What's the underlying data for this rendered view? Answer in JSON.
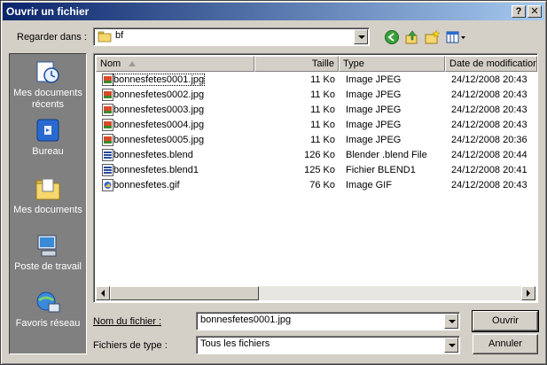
{
  "window": {
    "title": "Ouvrir un fichier",
    "help_btn": "?",
    "close_btn": "✕"
  },
  "lookin": {
    "label": "Regarder dans :",
    "value": "bf"
  },
  "places": [
    {
      "label": "Mes documents récents",
      "icon": "recent-documents-icon"
    },
    {
      "label": "Bureau",
      "icon": "desktop-icon"
    },
    {
      "label": "Mes documents",
      "icon": "my-documents-icon"
    },
    {
      "label": "Poste de travail",
      "icon": "my-computer-icon"
    },
    {
      "label": "Favoris réseau",
      "icon": "network-places-icon"
    }
  ],
  "columns": {
    "name": "Nom",
    "size": "Taille",
    "type": "Type",
    "date": "Date de modification"
  },
  "files": [
    {
      "name": "bonnesfetes0001.jpg",
      "size": "11 Ko",
      "type": "Image JPEG",
      "date": "24/12/2008 20:43",
      "icon": "jpeg-file-icon"
    },
    {
      "name": "bonnesfetes0002.jpg",
      "size": "11 Ko",
      "type": "Image JPEG",
      "date": "24/12/2008 20:43",
      "icon": "jpeg-file-icon"
    },
    {
      "name": "bonnesfetes0003.jpg",
      "size": "11 Ko",
      "type": "Image JPEG",
      "date": "24/12/2008 20:43",
      "icon": "jpeg-file-icon"
    },
    {
      "name": "bonnesfetes0004.jpg",
      "size": "11 Ko",
      "type": "Image JPEG",
      "date": "24/12/2008 20:43",
      "icon": "jpeg-file-icon"
    },
    {
      "name": "bonnesfetes0005.jpg",
      "size": "11 Ko",
      "type": "Image JPEG",
      "date": "24/12/2008 20:36",
      "icon": "jpeg-file-icon"
    },
    {
      "name": "bonnesfetes.blend",
      "size": "126 Ko",
      "type": "Blender .blend File",
      "date": "24/12/2008 20:44",
      "icon": "blend-file-icon"
    },
    {
      "name": "bonnesfetes.blend1",
      "size": "125 Ko",
      "type": "Fichier BLEND1",
      "date": "24/12/2008 20:41",
      "icon": "blend-file-icon"
    },
    {
      "name": "bonnesfetes.gif",
      "size": "76 Ko",
      "type": "Image GIF",
      "date": "24/12/2008 20:43",
      "icon": "gif-file-icon"
    }
  ],
  "filename": {
    "label": "Nom du fichier :",
    "value": "bonnesfetes0001.jpg"
  },
  "filetype": {
    "label": "Fichiers de type :",
    "value": "Tous les fichiers"
  },
  "buttons": {
    "open": "Ouvrir",
    "cancel": "Annuler"
  },
  "colors": {
    "title_start": "#0a246a",
    "title_end": "#a6caf0",
    "face": "#d4d0c8",
    "places_bg": "#808080"
  }
}
